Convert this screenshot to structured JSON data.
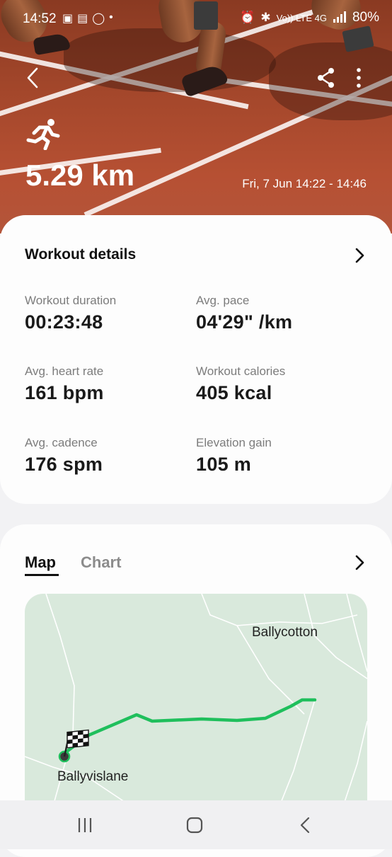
{
  "status_bar": {
    "time": "14:52",
    "network": "Vo)) LTE 4G",
    "battery": "80%"
  },
  "header": {
    "activity_icon": "running-icon",
    "distance": "5.29 km",
    "date_range": "Fri, 7 Jun 14:22 - 14:46"
  },
  "workout_details": {
    "title": "Workout details",
    "metrics": [
      {
        "label": "Workout duration",
        "value": "00:23:48"
      },
      {
        "label": "Avg. pace",
        "value": "04'29\" /km"
      },
      {
        "label": "Avg. heart rate",
        "value": "161 bpm"
      },
      {
        "label": "Workout calories",
        "value": "405 kcal"
      },
      {
        "label": "Avg. cadence",
        "value": "176 spm"
      },
      {
        "label": "Elevation gain",
        "value": "105 m"
      }
    ]
  },
  "map_section": {
    "tabs": [
      {
        "label": "Map",
        "active": true
      },
      {
        "label": "Chart",
        "active": false
      }
    ],
    "places": [
      "Ballycotton",
      "Ballyvislane"
    ],
    "route_color": "#1fbf5c"
  },
  "colors": {
    "accent_route": "#1fbf5c",
    "map_background": "#d9e9dc",
    "card_background": "#fdfdfd"
  }
}
